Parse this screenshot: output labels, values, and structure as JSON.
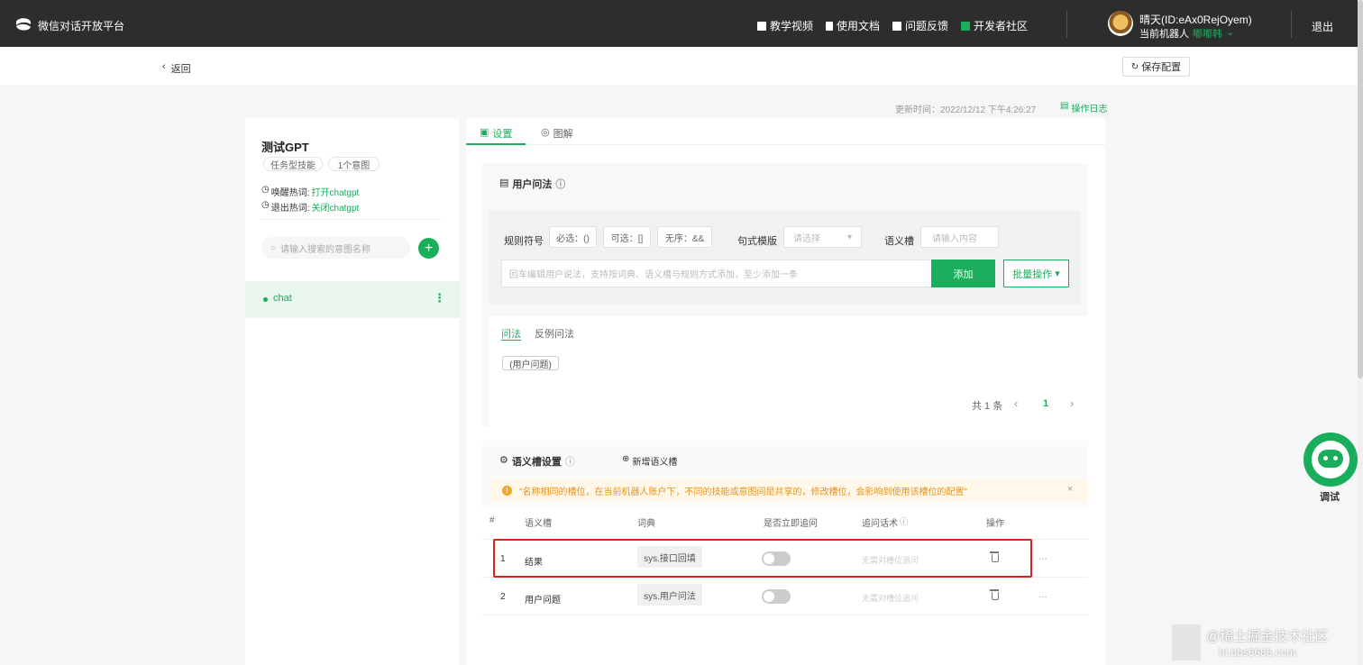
{
  "topbar": {
    "brand": "微信对话开放平台",
    "nav": [
      "教学视频",
      "使用文档",
      "问题反馈",
      "开发者社区"
    ],
    "user": "晴天(ID:eAx0RejOyem)",
    "robot_label": "当前机器人",
    "robot_name": "嘟嘟韩",
    "logout": "退出"
  },
  "subbar": {
    "back": "返回",
    "save": "保存配置"
  },
  "meta": {
    "updated": "更新时间：2022/12/12 下午4:26:27",
    "log": "操作日志"
  },
  "skill": {
    "name": "测试GPT",
    "tag1": "任务型技能",
    "tag2": "1个意图",
    "wake_label": "唤醒热词:",
    "wake_value": "打开chatgpt",
    "exit_label": "退出热词:",
    "exit_value": "关闭chatgpt",
    "search_placeholder": "请输入搜索的意图名称",
    "intent": "chat"
  },
  "tabs": {
    "settings": "设置",
    "diagram": "图解"
  },
  "utter": {
    "title": "用户问法",
    "rule_label": "规则符号",
    "required": "必选：()",
    "optional": "可选：[]",
    "unordered": "无序：&&",
    "template_label": "句式模版",
    "template_placeholder": "请选择",
    "slot_label": "语义槽",
    "slot_placeholder": "请输入内容",
    "input_placeholder": "回车编辑用户说法，支持按词典、语义槽与规则方式添加，至少添加一条",
    "add": "添加",
    "batch": "批量操作",
    "tab1": "问法",
    "tab2": "反例问法",
    "item": "(用户问题)",
    "total": "共 1 条",
    "page": "1"
  },
  "slots": {
    "title": "语义槽设置",
    "new": "新增语义槽",
    "warning": "\"名称相同的槽位，在当前机器人账户下，不同的技能或意图间是共享的，修改槽位，会影响到使用该槽位的配置\"",
    "headers": [
      "#",
      "语义槽",
      "词典",
      "是否立即追问",
      "追问话术",
      "操作"
    ],
    "rows": [
      {
        "idx": "1",
        "name": "结果",
        "dict": "sys.接口回填",
        "ask": "无需对槽位追问"
      },
      {
        "idx": "2",
        "name": "用户问题",
        "dict": "sys.用户问法",
        "ask": "无需对槽位追问"
      }
    ]
  },
  "debug": "调试",
  "watermark": {
    "text": "@稀土掘金技术社区",
    "url": "ht.bbs6666.com"
  },
  "colors": {
    "accent": "#1aad5b",
    "highlight": "#e02020"
  }
}
